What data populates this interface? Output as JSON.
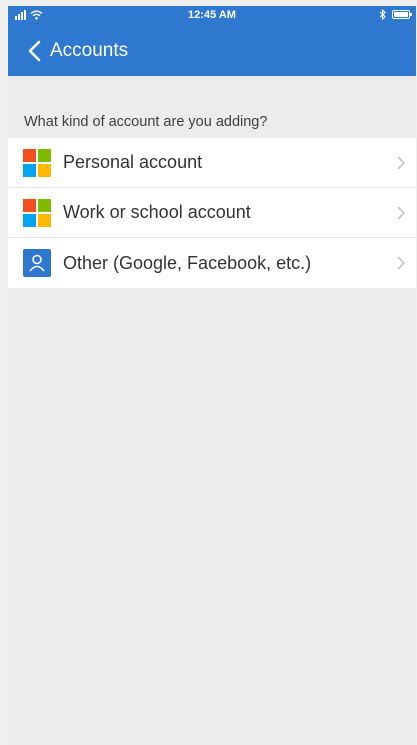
{
  "status_bar": {
    "time": "12:45 AM",
    "icons": [
      "signal-icon",
      "wifi-icon",
      "bluetooth-icon",
      "battery-icon"
    ]
  },
  "header": {
    "back_label": "Accounts",
    "background_color": "#2f78d0"
  },
  "prompt": "What kind of account are you adding?",
  "options": [
    {
      "label": "Personal account",
      "icon": "microsoft-logo-icon"
    },
    {
      "label": "Work or school account",
      "icon": "microsoft-logo-icon"
    },
    {
      "label": "Other (Google, Facebook, etc.)",
      "icon": "person-icon"
    }
  ]
}
